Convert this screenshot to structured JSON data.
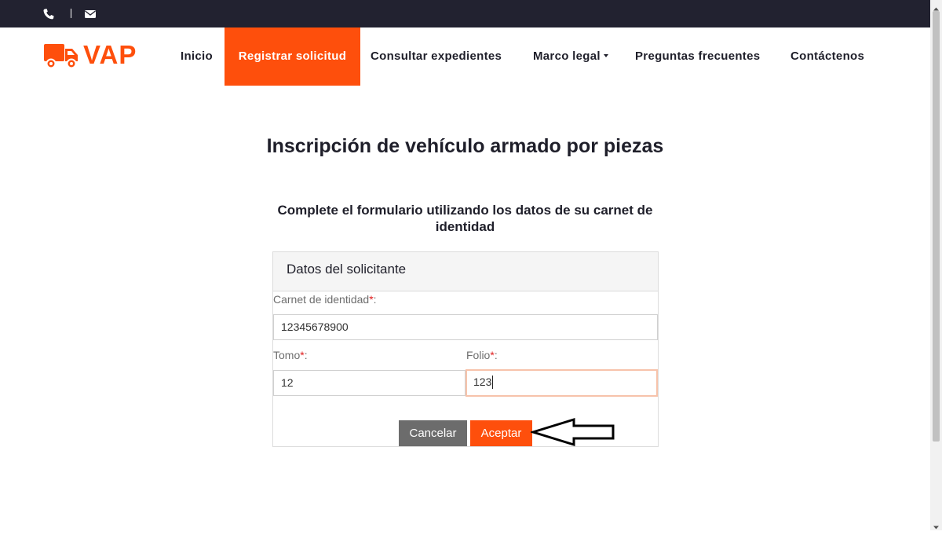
{
  "topbar": {
    "icons": [
      "phone-icon",
      "envelope-icon"
    ]
  },
  "brand": {
    "name": "VAP",
    "color": "#fe4f0c",
    "icon": "truck-icon"
  },
  "nav": {
    "items": [
      {
        "label": "Inicio",
        "active": false
      },
      {
        "label": "Registrar solicitud",
        "active": true
      },
      {
        "label": "Consultar expedientes",
        "active": false
      },
      {
        "label": "Marco legal",
        "active": false,
        "dropdown": true
      },
      {
        "label": "Preguntas frecuentes",
        "active": false
      },
      {
        "label": "Contáctenos",
        "active": false
      }
    ]
  },
  "main": {
    "title": "Inscripción de vehículo armado por piezas",
    "subtitle": "Complete el formulario utilizando los datos de su carnet de identidad"
  },
  "form": {
    "header": "Datos del solicitante",
    "required_mark": "*",
    "carnet": {
      "label": "Carnet de identidad",
      "value": "12345678900"
    },
    "tomo": {
      "label": "Tomo",
      "value": "12"
    },
    "folio": {
      "label": "Folio",
      "value": "123"
    },
    "cancel_label": "Cancelar",
    "accept_label": "Aceptar"
  },
  "colors": {
    "accent": "#fe4f0c",
    "topbar": "#222230",
    "cancel": "#6c6c6c"
  }
}
